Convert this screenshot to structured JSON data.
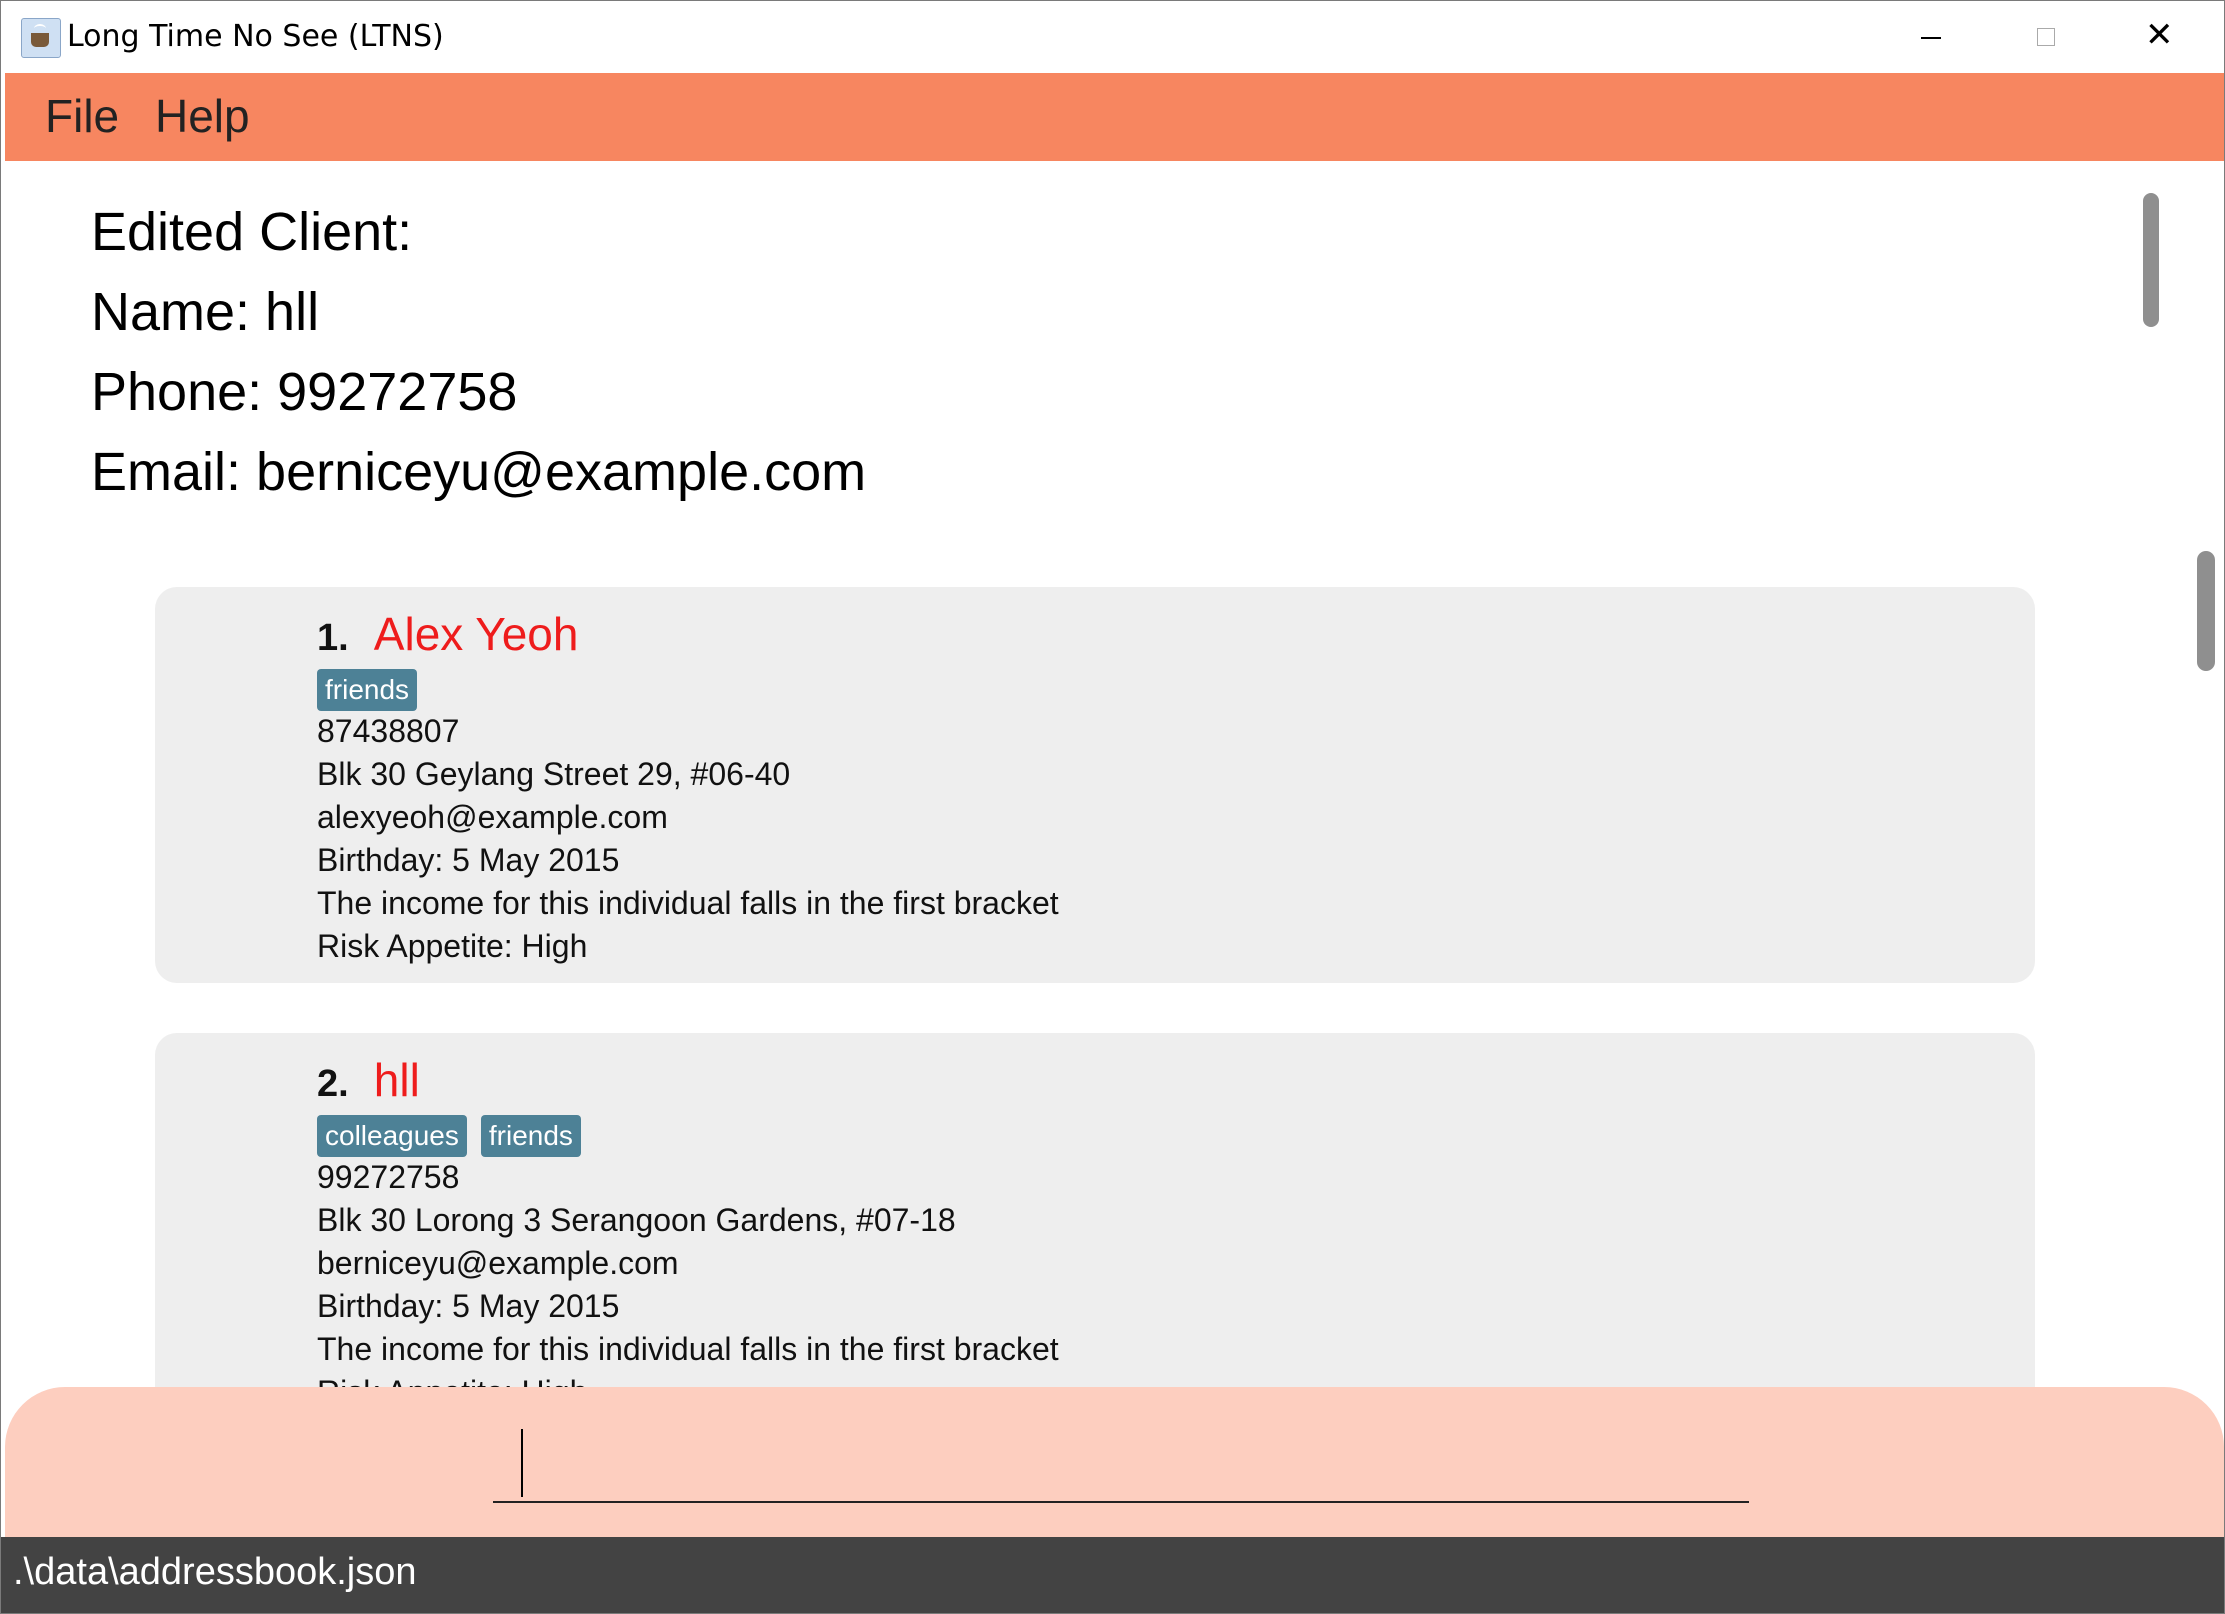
{
  "window": {
    "title": "Long Time No See (LTNS)"
  },
  "menu": {
    "file": "File",
    "help": "Help"
  },
  "result": {
    "lines": [
      "Edited Client:",
      "Name: hll",
      "Phone: 99272758",
      "Email: berniceyu@example.com"
    ]
  },
  "clients": [
    {
      "index": "1.",
      "name": "Alex Yeoh",
      "tags": [
        "friends"
      ],
      "phone": "87438807",
      "address": "Blk 30 Geylang Street 29, #06-40",
      "email": "alexyeoh@example.com",
      "birthday": "Birthday: 5 May 2015",
      "income": "The income for this individual falls in the first bracket",
      "risk": "Risk Appetite: High"
    },
    {
      "index": "2.",
      "name": "hll",
      "tags": [
        "colleagues",
        "friends"
      ],
      "phone": "99272758",
      "address": "Blk 30 Lorong 3 Serangoon Gardens, #07-18",
      "email": "berniceyu@example.com",
      "birthday": "Birthday: 5 May 2015",
      "income": "The income for this individual falls in the first bracket",
      "risk": "Risk Appetite: High"
    }
  ],
  "command": {
    "value": "",
    "placeholder": ""
  },
  "status": {
    "path": ".\\data\\addressbook.json"
  },
  "colors": {
    "menubar": "#f78660",
    "command_area": "#fdcebf",
    "status_bar": "#434343",
    "client_name": "#ee1c1c",
    "tag": "#4d8196",
    "card": "#eeeeee"
  }
}
